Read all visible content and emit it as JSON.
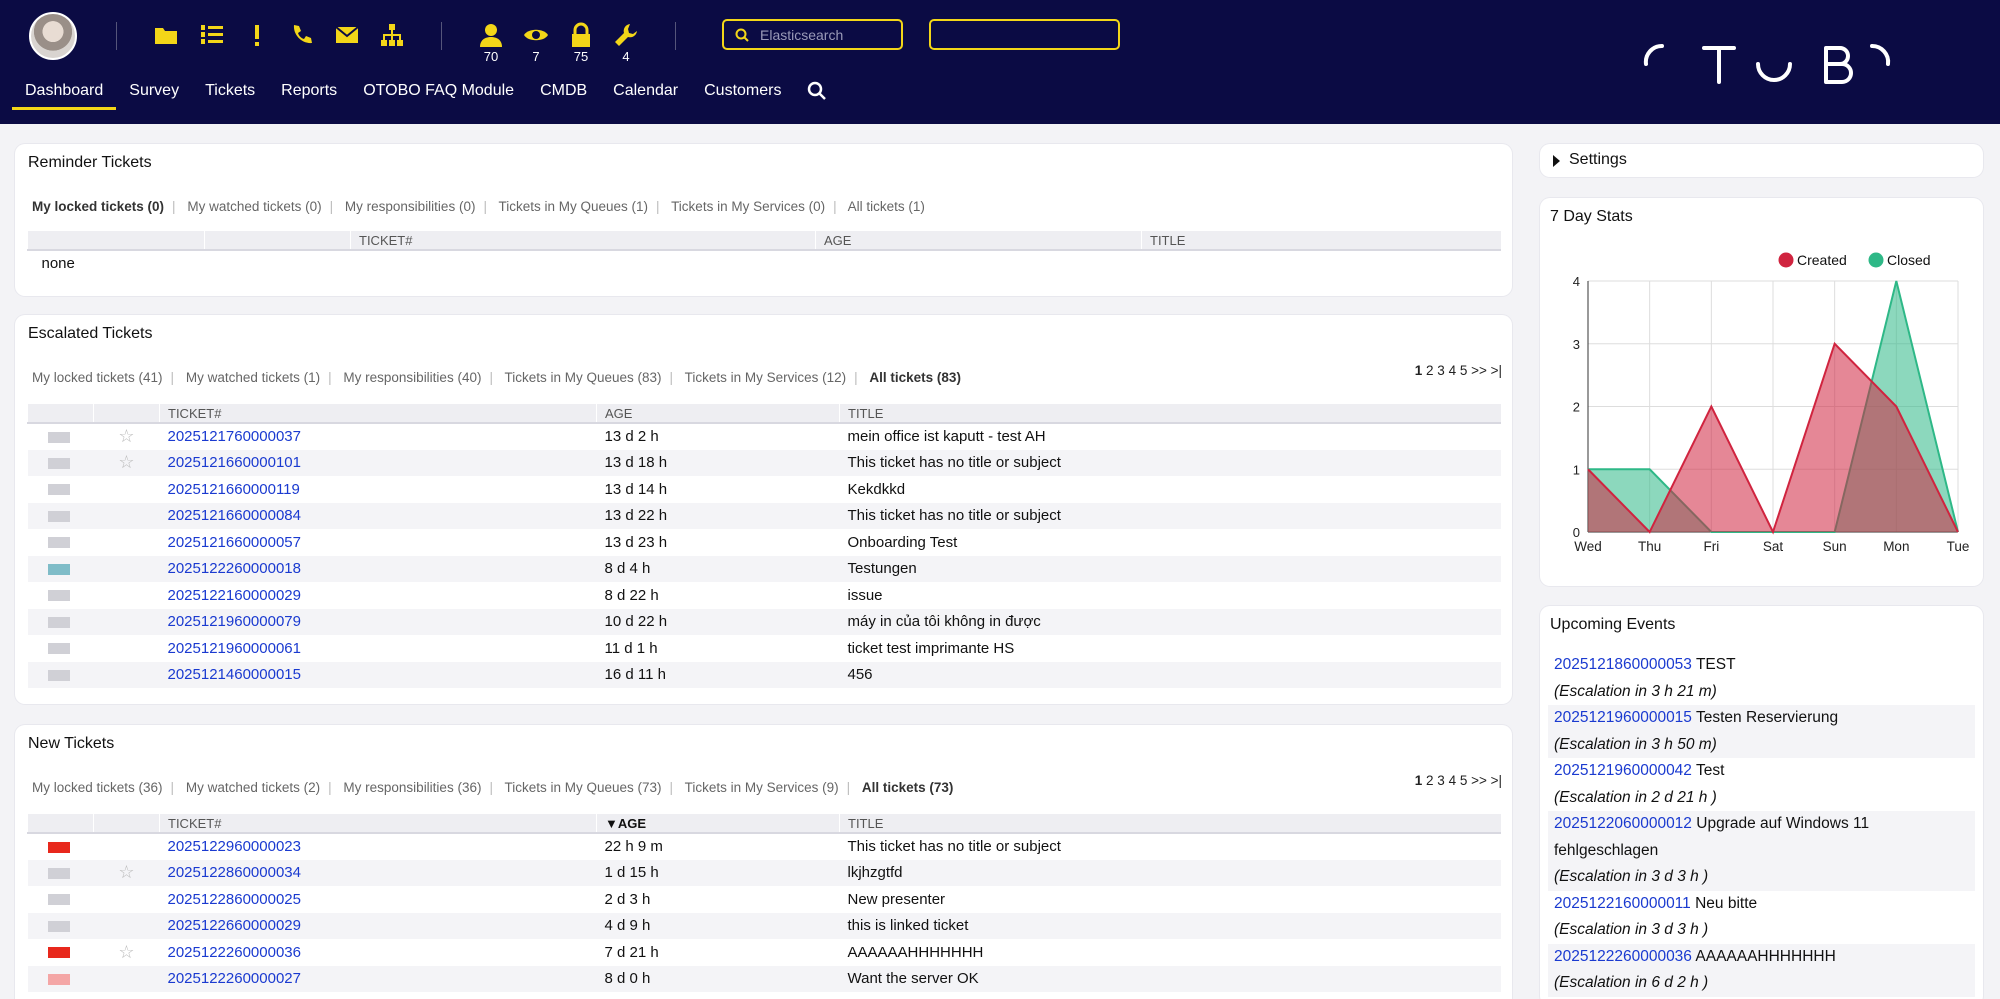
{
  "toolbar": {
    "counts": {
      "user": "70",
      "watch": "7",
      "lock": "75",
      "wrench": "4"
    },
    "search_placeholder": "Elasticsearch",
    "search2_value": ""
  },
  "nav": {
    "items": [
      "Dashboard",
      "Survey",
      "Tickets",
      "Reports",
      "OTOBO FAQ Module",
      "CMDB",
      "Calendar",
      "Customers"
    ]
  },
  "reminder": {
    "title": "Reminder Tickets",
    "filters": [
      "My locked tickets (0)",
      "My watched tickets (0)",
      "My responsibilities (0)",
      "Tickets in My Queues (1)",
      "Tickets in My Services (0)",
      "All tickets (1)"
    ],
    "columns": [
      "TICKET#",
      "AGE",
      "TITLE"
    ],
    "empty": "none"
  },
  "escalated": {
    "title": "Escalated Tickets",
    "filters": [
      "My locked tickets (41)",
      "My watched tickets (1)",
      "My responsibilities (40)",
      "Tickets in My Queues (83)",
      "Tickets in My Services (12)",
      "All tickets (83)"
    ],
    "pager": {
      "current": "1",
      "pages": "2 3 4 5 >> >|"
    },
    "columns": [
      "TICKET#",
      "AGE",
      "TITLE"
    ],
    "rows": [
      {
        "num": "2025121760000037",
        "age": "13 d 2 h",
        "title": "mein office ist kaputt - test AH",
        "flag": "#d0d0d6",
        "star": "☆"
      },
      {
        "num": "2025121660000101",
        "age": "13 d 18 h",
        "title": "This ticket has no title or subject",
        "flag": "#d0d0d6",
        "star": "☆"
      },
      {
        "num": "2025121660000119",
        "age": "13 d 14 h",
        "title": "Kekdkkd",
        "flag": "#d0d0d6",
        "star": ""
      },
      {
        "num": "2025121660000084",
        "age": "13 d 22 h",
        "title": "This ticket has no title or subject",
        "flag": "#d0d0d6",
        "star": ""
      },
      {
        "num": "2025121660000057",
        "age": "13 d 23 h",
        "title": "Onboarding Test",
        "flag": "#d0d0d6",
        "star": ""
      },
      {
        "num": "2025122260000018",
        "age": "8 d 4 h",
        "title": "Testungen",
        "flag": "#7fbcc8",
        "star": ""
      },
      {
        "num": "2025122160000029",
        "age": "8 d 22 h",
        "title": "issue",
        "flag": "#d0d0d6",
        "star": ""
      },
      {
        "num": "2025121960000079",
        "age": "10 d 22 h",
        "title": "máy in của tôi không in được",
        "flag": "#d0d0d6",
        "star": ""
      },
      {
        "num": "2025121960000061",
        "age": "11 d 1 h",
        "title": "ticket test imprimante HS",
        "flag": "#d0d0d6",
        "star": ""
      },
      {
        "num": "2025121460000015",
        "age": "16 d 11 h",
        "title": "456",
        "flag": "#d0d0d6",
        "star": ""
      }
    ]
  },
  "newtickets": {
    "title": "New Tickets",
    "filters": [
      "My locked tickets (36)",
      "My watched tickets (2)",
      "My responsibilities (36)",
      "Tickets in My Queues (73)",
      "Tickets in My Services (9)",
      "All tickets (73)"
    ],
    "pager": {
      "current": "1",
      "pages": "2 3 4 5 >> >|"
    },
    "columns": [
      "TICKET#",
      "▼AGE",
      "TITLE"
    ],
    "rows": [
      {
        "num": "2025122960000023",
        "age": "22 h 9 m",
        "title": "This ticket has no title or subject",
        "flag": "#e8281c",
        "star": ""
      },
      {
        "num": "2025122860000034",
        "age": "1 d 15 h",
        "title": "lkjhzgtfd",
        "flag": "#d0d0d6",
        "star": "☆"
      },
      {
        "num": "2025122860000025",
        "age": "2 d 3 h",
        "title": "New presenter",
        "flag": "#d0d0d6",
        "star": ""
      },
      {
        "num": "2025122660000029",
        "age": "4 d 9 h",
        "title": "this is linked ticket",
        "flag": "#d0d0d6",
        "star": ""
      },
      {
        "num": "2025122260000036",
        "age": "7 d 21 h",
        "title": "AAAAAAHHHHHHH",
        "flag": "#e8281c",
        "star": "☆"
      },
      {
        "num": "2025122260000027",
        "age": "8 d 0 h",
        "title": "Want the server OK",
        "flag": "#f4a6a6",
        "star": ""
      }
    ]
  },
  "settings": {
    "label": "Settings"
  },
  "stats": {
    "title": "7 Day Stats",
    "chart_data": {
      "type": "area",
      "categories": [
        "Wed",
        "Thu",
        "Fri",
        "Sat",
        "Sun",
        "Mon",
        "Tue"
      ],
      "series": [
        {
          "name": "Created",
          "values": [
            1,
            0,
            2,
            0,
            3,
            2,
            0
          ],
          "color": "#d0243f"
        },
        {
          "name": "Closed",
          "values": [
            1,
            1,
            0,
            0,
            0,
            4,
            0
          ],
          "color": "#2eb887"
        }
      ],
      "ylim": [
        0,
        4
      ],
      "yticks": [
        "0",
        "1",
        "2",
        "3",
        "4"
      ],
      "grid": true,
      "legend": "top-right"
    }
  },
  "events": {
    "title": "Upcoming Events",
    "items": [
      {
        "num": "2025121860000053",
        "title": "TEST",
        "esc": "(Escalation in 3 h 21 m)"
      },
      {
        "num": "2025121960000015",
        "title": "Testen Reservierung",
        "esc": "(Escalation in 3 h 50 m)"
      },
      {
        "num": "2025121960000042",
        "title": "Test",
        "esc": "(Escalation in 2 d 21 h )"
      },
      {
        "num": "2025122060000012",
        "title": "Upgrade auf Windows 11 fehlgeschlagen",
        "esc": "(Escalation in 3 d 3 h )"
      },
      {
        "num": "2025122160000011",
        "title": "Neu bitte",
        "esc": "(Escalation in 3 d 3 h )"
      },
      {
        "num": "2025122260000036",
        "title": "AAAAAAHHHHHHH",
        "esc": "(Escalation in 6 d 2 h )"
      }
    ]
  }
}
